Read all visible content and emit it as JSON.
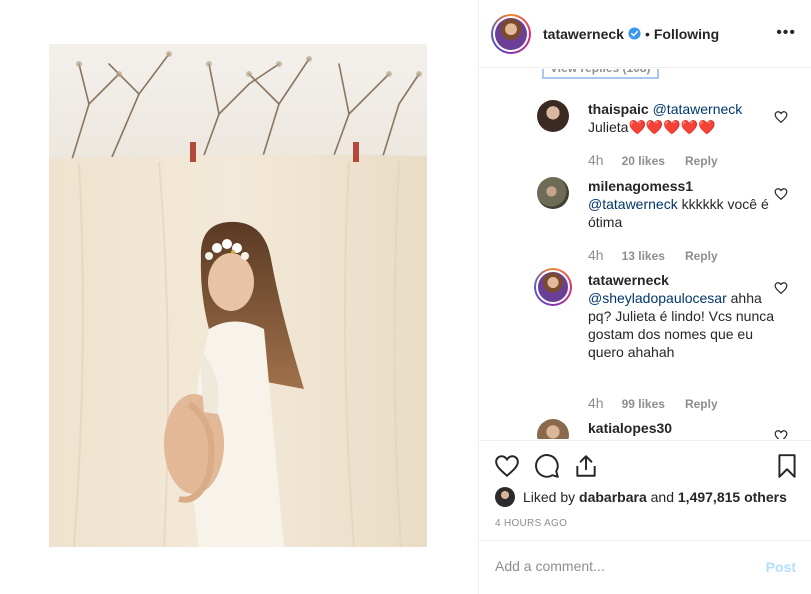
{
  "post": {
    "username": "tatawerneck",
    "verified": true,
    "separator": "•",
    "follow_status": "Following",
    "more_icon": "ellipsis-icon"
  },
  "comments": {
    "view_replies": "View replies (108)",
    "items": [
      {
        "username": "thaispaic",
        "mention": "@tatawerneck",
        "text": "Julieta❤️❤️❤️❤️❤️",
        "time": "4h",
        "likes": "20 likes",
        "reply": "Reply"
      },
      {
        "username": "milenagomess1",
        "mention": "@tatawerneck",
        "text": "kkkkkk você é ótima",
        "time": "4h",
        "likes": "13 likes",
        "reply": "Reply"
      },
      {
        "username": "tatawerneck",
        "mention": "@sheyladopaulocesar",
        "text": "ahha pq? Julieta é lindo! Vcs nunca gostam dos nomes que eu quero ahahah",
        "time": "4h",
        "likes": "99 likes",
        "reply": "Reply"
      },
      {
        "username": "katialopes30",
        "mention": "",
        "text": "",
        "time": "",
        "likes": "",
        "reply": ""
      }
    ]
  },
  "actions": {
    "icons": [
      "heart-icon",
      "comment-icon",
      "share-icon",
      "bookmark-icon"
    ],
    "liked_by_prefix": "Liked by",
    "liked_by_user": "dabarbara",
    "liked_by_and": "and",
    "liked_by_count": "1,497,815 others",
    "time_ago": "4 HOURS AGO"
  },
  "add_comment": {
    "placeholder": "Add a comment...",
    "post_label": "Post"
  },
  "colors": {
    "text": "#262626",
    "secondary": "#8e8e8e",
    "mention": "#00376b",
    "verified": "#3897f0",
    "post_disabled": "#b2dffc",
    "border": "#efefef"
  }
}
